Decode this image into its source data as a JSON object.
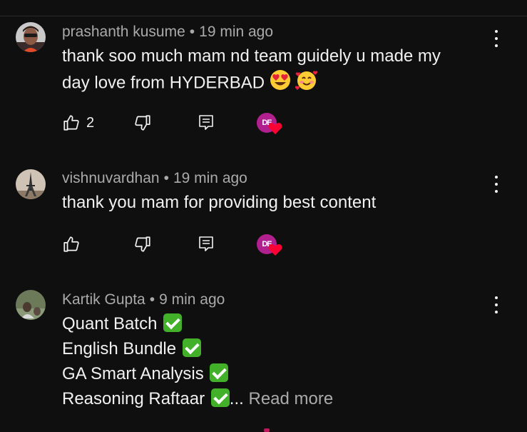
{
  "comments": [
    {
      "author": "prashanth kusume",
      "time": "19 min ago",
      "lines": [
        "thank soo much mam nd team guidely u made my",
        "day love from HYDERBAD"
      ],
      "emojis": [
        "heart-eyes",
        "smiling-face-with-hearts"
      ],
      "likes": "2"
    },
    {
      "author": "vishnuvardhan",
      "time": "19 min ago",
      "lines": [
        "thank you mam for providing best content"
      ],
      "likes": ""
    },
    {
      "author": "Kartik Gupta",
      "time": "9 min ago",
      "lines": [
        "Quant Batch",
        "English Bundle",
        "GA Smart Analysis",
        "Reasoning Raftaar"
      ],
      "ellipsis": "...",
      "read_more": "Read more"
    }
  ],
  "icons": {
    "like": "thumbs-up-icon",
    "dislike": "thumbs-down-icon",
    "reply": "reply-comment-icon",
    "more": "more-vertical-icon",
    "creator_heart": "creator-heart-icon",
    "check": "check-mark-emoji"
  },
  "colors": {
    "background": "#0f0f0f",
    "text": "#f1f1f1",
    "meta": "#aaaaaa",
    "heart": "#ff0033",
    "creator_logo": "#b0208f",
    "check": "#43b02a"
  }
}
